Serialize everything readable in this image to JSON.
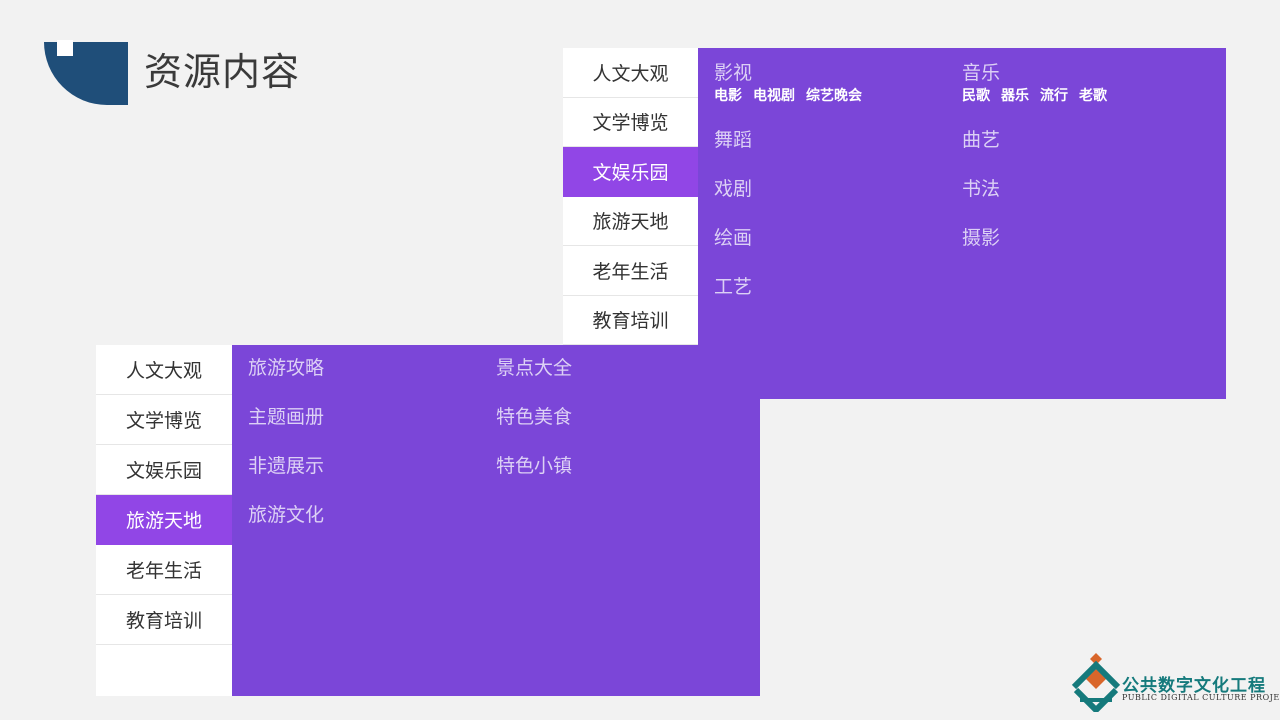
{
  "page": {
    "title": "资源内容"
  },
  "colors": {
    "title_block": "#1f4e79",
    "content_bg": "#7b46d8",
    "active_nav": "#9146e6",
    "logo_teal": "#157a7c",
    "logo_orange": "#d9662b"
  },
  "panel_a": {
    "nav": [
      "人文大观",
      "文学博览",
      "文娱乐园",
      "旅游天地",
      "老年生活",
      "教育培训"
    ],
    "active": "文娱乐园",
    "col1": [
      {
        "label": "影视",
        "subs": [
          "电影",
          "电视剧",
          "综艺晚会"
        ]
      },
      {
        "label": "舞蹈"
      },
      {
        "label": "戏剧"
      },
      {
        "label": "绘画"
      },
      {
        "label": "工艺"
      }
    ],
    "col2": [
      {
        "label": "音乐",
        "subs": [
          "民歌",
          "器乐",
          "流行",
          "老歌"
        ]
      },
      {
        "label": "曲艺"
      },
      {
        "label": "书法"
      },
      {
        "label": "摄影"
      }
    ]
  },
  "panel_b": {
    "nav": [
      "人文大观",
      "文学博览",
      "文娱乐园",
      "旅游天地",
      "老年生活",
      "教育培训"
    ],
    "active": "旅游天地",
    "col1": [
      {
        "label": "旅游攻略"
      },
      {
        "label": "主题画册"
      },
      {
        "label": "非遗展示"
      },
      {
        "label": "旅游文化"
      }
    ],
    "col2": [
      {
        "label": "景点大全"
      },
      {
        "label": "特色美食"
      },
      {
        "label": "特色小镇"
      }
    ]
  },
  "logo": {
    "cn": "公共数字文化工程",
    "en": "PUBLIC DIGITAL CULTURE PROJECT"
  }
}
